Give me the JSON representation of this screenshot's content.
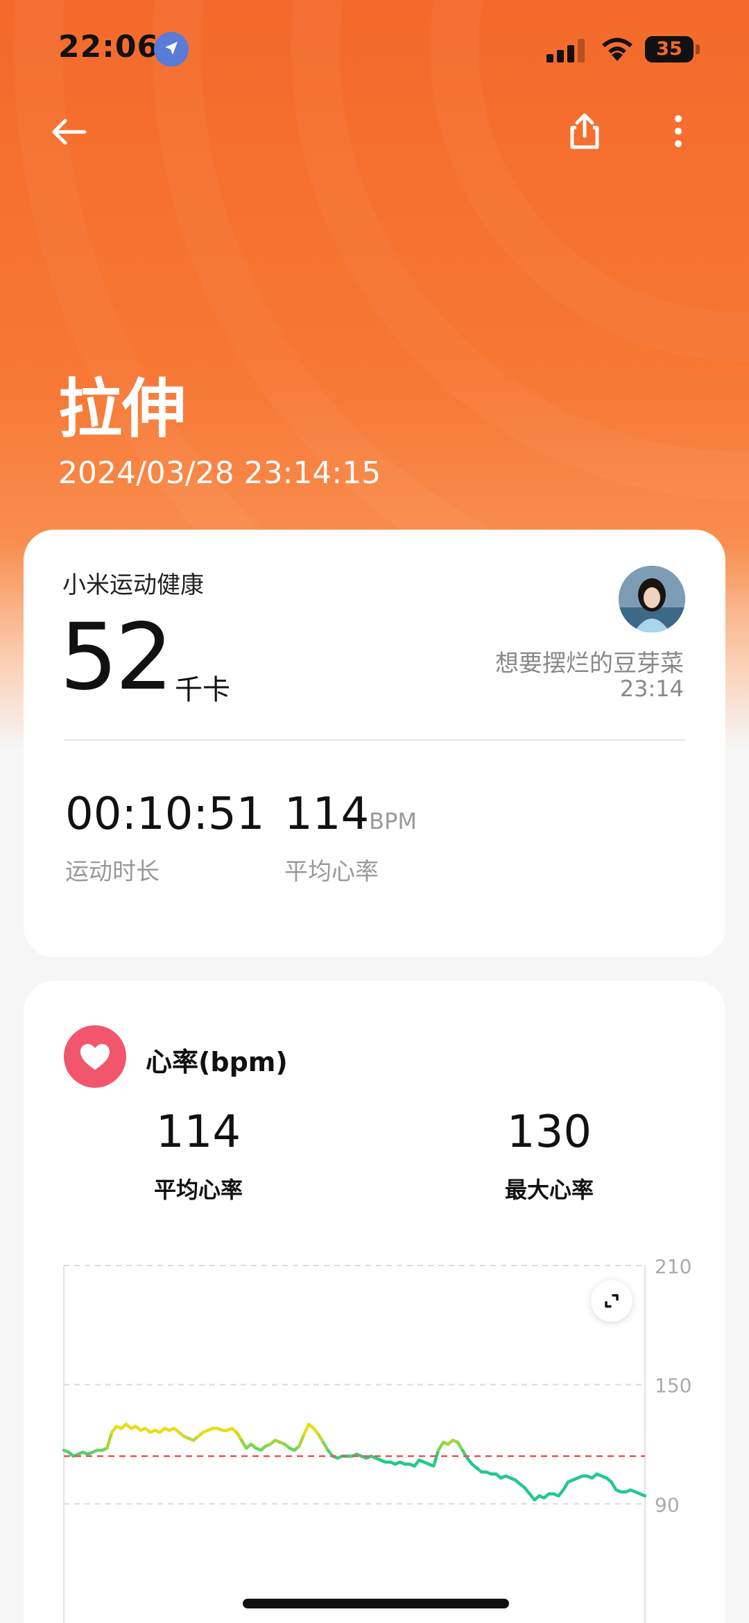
{
  "status_bar": {
    "time": "22:06",
    "battery": "35"
  },
  "header": {
    "back_icon": "arrow-left-icon",
    "share_icon": "share-icon",
    "more_icon": "more-vertical-icon",
    "title": "拉伸",
    "datetime": "2024/03/28 23:14:15"
  },
  "summary": {
    "source": "小米运动健康",
    "calories": "52",
    "calories_unit": "千卡",
    "username": "想要摆烂的豆芽菜",
    "user_time": "23:14",
    "duration_value": "00:10:51",
    "duration_label": "运动时长",
    "avg_hr_value": "114",
    "avg_hr_unit": "BPM",
    "avg_hr_label": "平均心率"
  },
  "heart_rate": {
    "icon": "heart-icon",
    "title": "心率(bpm)",
    "avg_value": "114",
    "avg_label": "平均心率",
    "max_value": "130",
    "max_label": "最大心率"
  },
  "colors": {
    "accent": "#f46a2c",
    "heart": "#f2566d",
    "line_low": "#22c98b",
    "line_high": "#e8dd18",
    "avg_line": "#f05050"
  },
  "chart_data": {
    "type": "line",
    "ylabel": "",
    "ylim": [
      30,
      210
    ],
    "yticks": [
      "210",
      "150",
      "90"
    ],
    "avg_reference": 114,
    "grid": true,
    "series": [
      {
        "values": [
          117,
          116,
          114,
          115,
          116,
          115,
          116,
          117,
          117,
          118,
          126,
          129,
          128,
          130,
          128,
          129,
          127,
          128,
          126,
          127,
          126,
          128,
          127,
          128,
          126,
          124,
          123,
          122,
          124,
          126,
          127,
          128,
          128,
          127,
          127,
          128,
          126,
          122,
          118,
          120,
          118,
          117,
          119,
          120,
          122,
          121,
          120,
          118,
          117,
          119,
          125,
          130,
          128,
          125,
          121,
          117,
          114,
          113,
          114,
          114,
          114,
          115,
          114,
          113,
          114,
          113,
          112,
          111,
          111,
          110,
          111,
          110,
          110,
          109,
          112,
          111,
          110,
          109,
          117,
          121,
          120,
          122,
          121,
          117,
          113,
          110,
          108,
          106,
          106,
          105,
          105,
          103,
          104,
          103,
          102,
          100,
          98,
          95,
          92,
          94,
          93,
          95,
          95,
          94,
          97,
          101,
          102,
          103,
          104,
          104,
          103,
          105,
          104,
          103,
          101,
          97,
          96,
          96,
          97,
          96,
          95,
          94
        ]
      }
    ]
  }
}
